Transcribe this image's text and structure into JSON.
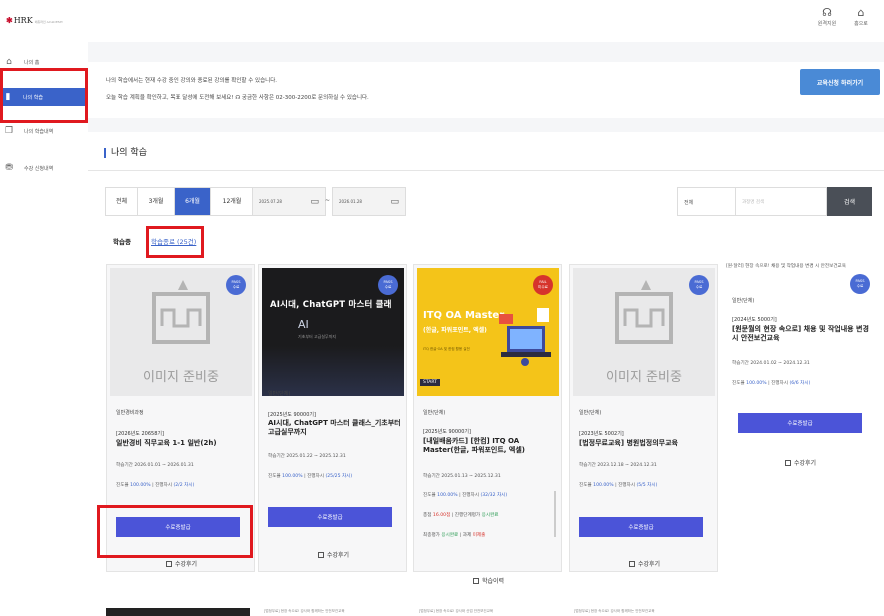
{
  "header": {
    "logo_text": "HRK",
    "logo_sub": "에듀라인 ACADEMY",
    "icons": [
      {
        "name": "headset-icon",
        "label": "원격지원"
      },
      {
        "name": "home-icon",
        "label": "홈으로"
      }
    ]
  },
  "sidebar": {
    "items": [
      {
        "name": "sidebar-item-home",
        "icon": "home-icon",
        "label": "나의 홈"
      },
      {
        "name": "sidebar-item-my-learning",
        "icon": "book-icon",
        "label": "나의 학습"
      },
      {
        "name": "sidebar-item-learning-history",
        "icon": "document-icon",
        "label": "나의 학습내역"
      },
      {
        "name": "sidebar-item-enrollment-history",
        "icon": "cart-icon",
        "label": "수강 신청내역"
      }
    ]
  },
  "notice": {
    "line1": "나의 학습에서는 현재 수강 중인 강의와 종료된 강의를 확인할 수 있습니다.",
    "line2": "오늘 학습 계획을 확인하고, 목표 달성에 도전해 보세요!   ☊ 궁금한 사항은 02-300-2200로 문의하실 수 있습니다.",
    "cta_label": "교육신청 하러가기"
  },
  "panel": {
    "title": "나의 학습",
    "filters": [
      "전체",
      "3개월",
      "6개월",
      "12개월"
    ],
    "selected_filter": "6개월",
    "date_from": "2025.07.28",
    "date_sep": "~",
    "date_to": "2026.01.28",
    "search_scope": "전체",
    "search_placeholder": "과정명 검색",
    "search_button": "검색",
    "tabs": [
      "학습중",
      "학습종료 (25건)"
    ]
  },
  "cards": [
    {
      "image": "placeholder",
      "placeholder_text": "이미지 준비중",
      "badge": {
        "top": "PASS",
        "bottom": "수료"
      },
      "category": "일반경비과정",
      "year_code": "[2026년도 20658기]",
      "title": "일반경비 직무교육 1-1 일반(2h)",
      "period": "학습기간  2026.01.01 ~ 2026.01.31",
      "progress_label": "진도율",
      "progress": "100.00%",
      "progress_extra": "| 진행차시",
      "sessions": "(2/2 차시)",
      "button": "수료증발급",
      "review": "수강후기"
    },
    {
      "image": "ai",
      "img_title": "AI시대, ChatGPT 마스터 클래",
      "img_sub": "AI",
      "img_tag": "기초부터 고급실무까지",
      "badge": {
        "top": "PASS",
        "bottom": "수료"
      },
      "category": "일반(단체)",
      "year_code": "[2025년도 90000기]",
      "title": "AI시대, ChatGPT 마스터 클래스_기초부터 고급실무까지",
      "period": "학습기간  2025.01.22 ~ 2025.12.31",
      "progress_label": "진도율",
      "progress": "100.00%",
      "progress_extra": "| 진행차시",
      "sessions": "(25/25 차시)",
      "button": "수료증발급",
      "review": "수강후기"
    },
    {
      "image": "itq",
      "img_title": "ITQ OA Master",
      "img_sub": "(한글, 파워포인트, 엑셀)",
      "img_desc": "ITQ 한글·OA 및 한컴 활용 실전",
      "img_start": "START",
      "badge": {
        "top": "FAIL",
        "bottom": "미수료"
      },
      "category": "일반(단체)",
      "year_code": "[2025년도 90000기]",
      "title": "[내일배움카드] [한컴] ITQ OA Master(한글, 파워포인트, 엑셀)",
      "period": "학습기간  2025.01.13 ~ 2025.12.31",
      "progress_label": "진도율",
      "progress": "100.00%",
      "progress_extra": "| 진행차시",
      "sessions": "(32/32 차시)",
      "score_line": {
        "label": "총점",
        "value": "16.00점",
        "mid": "| 진행단계평가",
        "status": "응시완료"
      },
      "final_line": {
        "label": "최종평가",
        "status1": "응시완료",
        "mid": "| 과제",
        "status2": "미제출"
      },
      "button": "학습이력",
      "review_icon": true
    },
    {
      "image": "placeholder",
      "placeholder_text": "이미지 준비중",
      "badge": {
        "top": "PASS",
        "bottom": "수료"
      },
      "category": "일반(단체)",
      "year_code": "[2023년도 5002기]",
      "title": "[법정무료교육] 병원법정의무교육",
      "period": "학습기간  2023.12.18 ~ 2024.12.31",
      "progress_label": "진도율",
      "progress": "100.00%",
      "progress_extra": "| 진행차시",
      "sessions": "(5/5 차시)",
      "button": "수료증발급",
      "review": "수강후기"
    },
    {
      "image": "broken",
      "broken_alt": "[원·달러] 현장 속으로! 채용 및 작업내용 변경 시 안전보건교육",
      "badge": {
        "top": "PASS",
        "bottom": "수료"
      },
      "category": "일반(단체)",
      "year_code": "[2024년도 5000기]",
      "title": "[원문월의 현장 속으로] 채용 및 작업내용 변경 시 안전보건교육",
      "period": "학습기간  2024.01.02 ~ 2024.12.31",
      "progress_label": "진도율",
      "progress": "100.00%",
      "progress_extra": "| 진행차시",
      "sessions": "(6/6 차시)",
      "button": "수료증발급",
      "review": "수강후기"
    }
  ],
  "bottom_row": [
    "[법정무료] 현장 속으로! 강사와 함께하는 안전보건교육",
    "[법정무료] 현장 속으로! 강사와 산업 안전보건교육",
    "[법정무료] 현장 속으로! 강사와 함께하는 안전보건교육"
  ]
}
